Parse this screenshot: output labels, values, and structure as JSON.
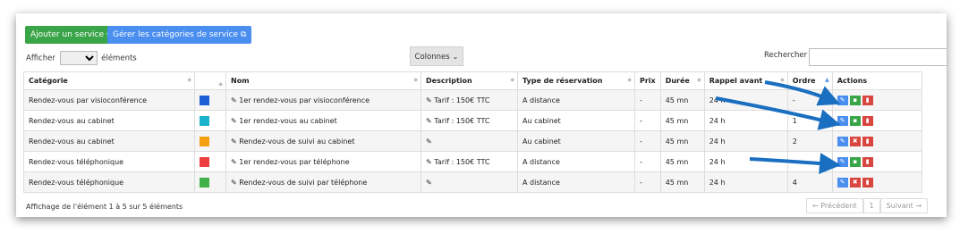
{
  "toolbar": {
    "add_service": "Ajouter un service ✚",
    "manage_categories": "Gérer les catégories de service ⧉"
  },
  "length": {
    "prefix": "Afficher",
    "suffix": "éléments"
  },
  "columns_button": "Colonnes ⌄",
  "search_label": "Rechercher :",
  "table": {
    "headers": [
      "Catégorie",
      "",
      "Nom",
      "Description",
      "Type de réservation",
      "Prix",
      "Durée",
      "Rappel avant",
      "Ordre",
      "Actions"
    ],
    "rows": [
      {
        "category": "Rendez-vous par visioconférence",
        "color": "#1a5fd6",
        "name": "1er rendez-vous par visioconférence",
        "description": "Tarif : 150€ TTC",
        "type": "A distance",
        "price": "-",
        "duration": "45 mn",
        "reminder": "24 h",
        "order": "-"
      },
      {
        "category": "Rendez-vous au cabinet",
        "color": "#19b4cc",
        "name": "1er rendez-vous au cabinet",
        "description": "Tarif : 150€ TTC",
        "type": "Au cabinet",
        "price": "-",
        "duration": "45 mn",
        "reminder": "24 h",
        "order": "1"
      },
      {
        "category": "Rendez-vous au cabinet",
        "color": "#f5a011",
        "name": "Rendez-vous de suivi au cabinet",
        "description": "",
        "type": "Au cabinet",
        "price": "-",
        "duration": "45 mn",
        "reminder": "24 h",
        "order": "2"
      },
      {
        "category": "Rendez-vous téléphonique",
        "color": "#ee3f3f",
        "name": "1er rendez-vous par téléphone",
        "description": "Tarif : 150€ TTC",
        "type": "A distance",
        "price": "-",
        "duration": "45 mn",
        "reminder": "24 h",
        "order": "-"
      },
      {
        "category": "Rendez-vous téléphonique",
        "color": "#40b048",
        "name": "Rendez-vous de suivi par téléphone",
        "description": "",
        "type": "A distance",
        "price": "-",
        "duration": "45 mn",
        "reminder": "24 h",
        "order": "4"
      }
    ]
  },
  "footer_info": "Affichage de l'élément 1 à 5 sur 5 éléments",
  "pagination": {
    "prev": "← Précédent",
    "page": "1",
    "next": "Suivant →"
  }
}
